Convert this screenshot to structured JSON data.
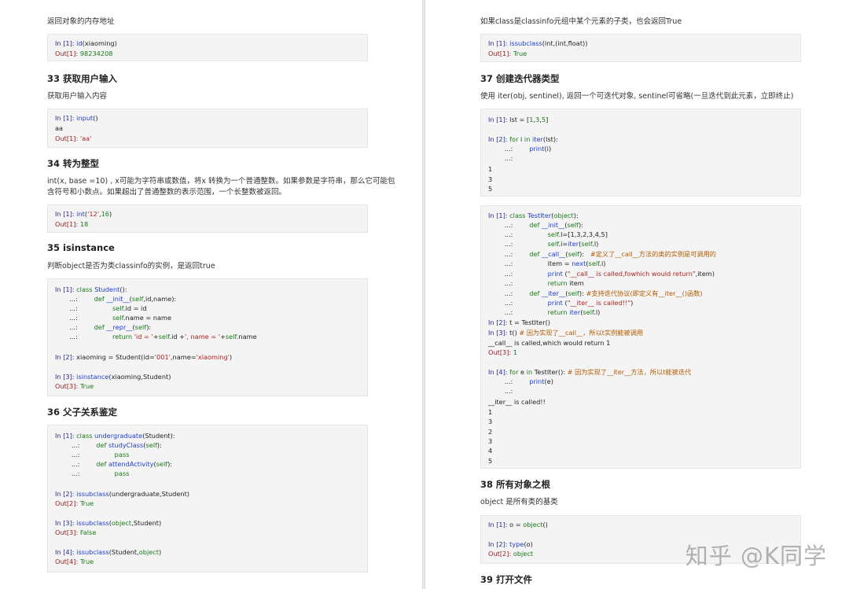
{
  "left": {
    "intro": "返回对象的内存地址",
    "block_id": [
      "In [1]: id(xiaoming)",
      "Out[1]: 98234208"
    ],
    "h33": "33 获取用户输入",
    "p33": "获取用户输入内容",
    "block_input": [
      "In [1]: input()",
      "aa",
      "Out[1]: 'aa'"
    ],
    "h34": "34 转为整型",
    "p34a": "int(x, base =10) , x可能为字符串或数值，将x 转换为一个普通整数。如果参数是字符串，那么它可能包",
    "p34b": "含符号和小数点。如果超出了普通整数的表示范围，一个长整数被返回。",
    "block_int": [
      "In [1]: int('12',16)",
      "Out[1]: 18"
    ],
    "h35": "35 isinstance",
    "p35": "判断object是否为类classinfo的实例，是返回true",
    "block_isinstance": [
      "In [1]: class Student():",
      "   ...:     def __init__(self,id,name):",
      "   ...:         self.id = id",
      "   ...:         self.name = name",
      "   ...:     def __repr__(self):",
      "   ...:         return 'id = '+self.id +', name = '+self.name",
      "",
      "In [2]: xiaoming = Student(id='001',name='xiaoming')",
      "",
      "In [3]: isinstance(xiaoming,Student)",
      "Out[3]: True"
    ],
    "h36": "36 父子关系鉴定",
    "block_issubclass": [
      "In [1]: class undergraduate(Student):",
      "    ...:     def studyClass(self):",
      "    ...:         pass",
      "    ...:     def attendActivity(self):",
      "    ...:         pass",
      "",
      "In [2]: issubclass(undergraduate,Student)",
      "Out[2]: True",
      "",
      "In [3]: issubclass(object,Student)",
      "Out[3]: False",
      "",
      "In [4]: issubclass(Student,object)",
      "Out[4]: True"
    ]
  },
  "right": {
    "intro": "如果class是classinfo元组中某个元素的子类，也会返回True",
    "block_tuple": [
      "In [1]: issubclass(int,(int,float))",
      "Out[1]: True"
    ],
    "h37": "37 创建迭代器类型",
    "p37": "使用 iter(obj, sentinel), 返回一个可迭代对象, sentinel可省略(一旦迭代到此元素，立即终止)",
    "block_iter": [
      "In [1]: lst = [1,3,5]",
      "",
      "In [2]: for i in iter(lst):",
      "    ...:     print(i)",
      "    ...:",
      "1",
      "3",
      "5"
    ],
    "block_testiter": [
      "In [1]: class TestIter(object):",
      "    ...:     def __init__(self):",
      "    ...:         self.l=[1,3,2,3,4,5]",
      "    ...:         self.i=iter(self.l)",
      "    ...:     def __call__(self):  #定义了__call__方法的类的实例是可调用的",
      "    ...:         item = next(self.i)",
      "    ...:         print (\"__call__ is called,fowhich would return\",item)",
      "    ...:         return item",
      "    ...:     def __iter__(self): #支持迭代协议(即定义有__iter__()函数)",
      "    ...:         print (\"__iter__ is called!!\")",
      "    ...:         return iter(self.l)",
      "In [2]: t = TestIter()",
      "In [3]: t() # 因为实现了__call__，所以t实例能被调用",
      "__call__ is called,which would return 1",
      "Out[3]: 1",
      "",
      "In [4]: for e in TestIter(): # 因为实现了__iter__方法，所以t能被迭代",
      "    ...:     print(e)",
      "    ...:",
      "__iter__ is called!!",
      "1",
      "3",
      "2",
      "3",
      "4",
      "5"
    ],
    "h38": "38 所有对象之根",
    "p38": "object 是所有类的基类",
    "block_object": [
      "In [1]: o = object()",
      "",
      "In [2]: type(o)",
      "Out[2]: object"
    ],
    "h39": "39 打开文件"
  },
  "watermark": "知乎 @K同学"
}
